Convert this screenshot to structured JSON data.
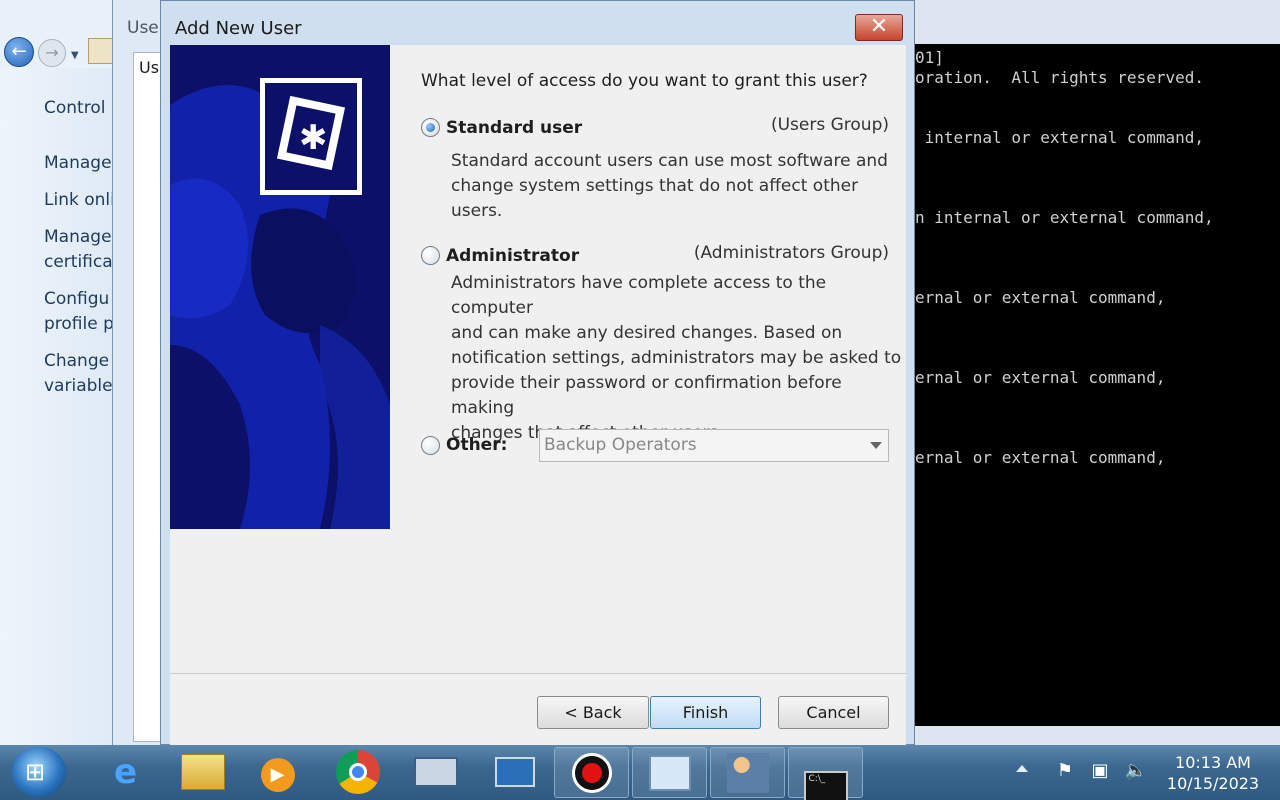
{
  "background_window": {
    "title": "User",
    "tab_label": "Use",
    "side_links": [
      "Control",
      "Manage",
      "Link onli",
      "Manage",
      "certificat",
      "Configu",
      "profile p",
      "Change",
      "variables"
    ]
  },
  "console": {
    "lines": [
      "01]",
      "oration.  All rights reserved.",
      " internal or external command,",
      "n internal or external command,",
      "ernal or external command,",
      "ernal or external command,",
      "ernal or external command,"
    ]
  },
  "dialog": {
    "title": "Add New User",
    "close_label": "✕",
    "question": "What level of access do you want to grant this user?",
    "options": [
      {
        "label": "Standard user",
        "group": "(Users Group)",
        "checked": true,
        "description": [
          "Standard account users can use most software and",
          "change system settings that do not affect other users."
        ]
      },
      {
        "label": "Administrator",
        "group": "(Administrators Group)",
        "checked": false,
        "description": [
          "Administrators have complete access to the computer",
          "and can make any desired changes. Based on",
          "notification settings, administrators may be asked to",
          "provide their password or confirmation before making",
          "changes that affect other users."
        ]
      },
      {
        "label": "Other:",
        "checked": false,
        "select_value": "Backup Operators"
      }
    ],
    "buttons": {
      "back": "< Back",
      "finish": "Finish",
      "cancel": "Cancel"
    }
  },
  "taskbar": {
    "items": [
      "internet-explorer-icon",
      "file-explorer-icon",
      "media-player-icon",
      "chrome-icon",
      "keyboard-icon",
      "computer-management-icon",
      "record-icon",
      "network-icon",
      "users-icon",
      "command-prompt-icon"
    ],
    "clock_time": "10:13 AM",
    "clock_date": "10/15/2023"
  },
  "colors": {
    "banner": "#0c1068",
    "console": "#000000",
    "taskbar": "#3b6790",
    "accent": "#2563b8"
  }
}
